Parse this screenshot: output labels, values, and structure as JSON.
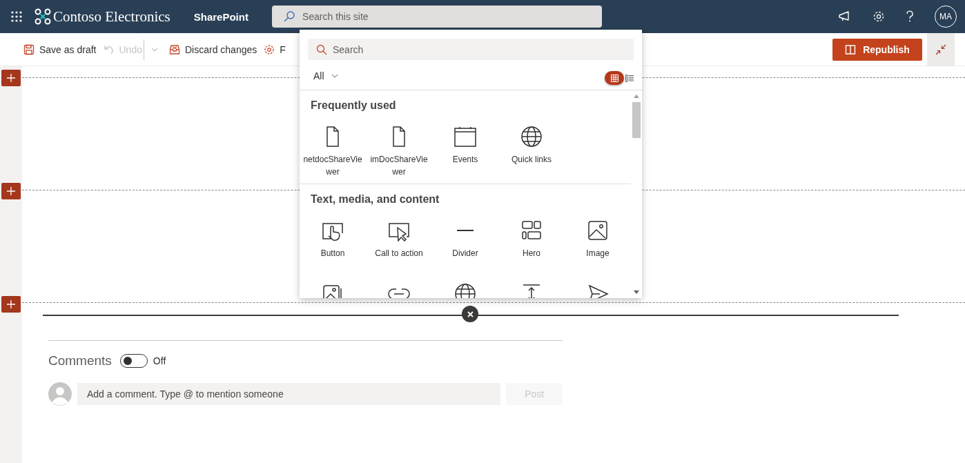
{
  "header": {
    "brand": "Contoso Electronics",
    "app": "SharePoint",
    "search": {
      "placeholder": "Search this site"
    },
    "avatar": "MA"
  },
  "toolbar": {
    "items": [
      {
        "kind": "save",
        "label": "Save as draft",
        "disabled": false
      },
      {
        "kind": "undo",
        "label": "Undo",
        "disabled": true
      },
      {
        "kind": "discard",
        "label": "Discard changes",
        "disabled": false
      },
      {
        "kind": "settings",
        "label": "F",
        "disabled": false
      }
    ],
    "publish": "Republish"
  },
  "sections": [
    {
      "kind": "add"
    },
    {
      "kind": "add"
    },
    {
      "kind": "add"
    }
  ],
  "toolbox": {
    "search": {
      "placeholder": "Search"
    },
    "filter": "All",
    "views": [
      {
        "kind": "grid",
        "selected": true
      },
      {
        "kind": "list",
        "selected": false
      }
    ],
    "groups": [
      {
        "heading": "Frequently used",
        "tiles": [
          {
            "label": "netdocShareViewer"
          },
          {
            "label": "imDocShareViewer"
          },
          {
            "label": "Events"
          },
          {
            "label": "Quick links"
          }
        ]
      },
      {
        "heading": "Text, media, and content",
        "tiles": [
          {
            "label": "Button"
          },
          {
            "label": "Call to action"
          },
          {
            "label": "Divider"
          },
          {
            "label": "Hero"
          },
          {
            "label": "Image"
          }
        ]
      }
    ]
  },
  "comments": {
    "label": "Comments",
    "on": false,
    "state_label": "Off",
    "input": {
      "placeholder": "Add a comment. Type @ to mention someone"
    },
    "post": {
      "label": "Post",
      "disabled": true
    }
  }
}
